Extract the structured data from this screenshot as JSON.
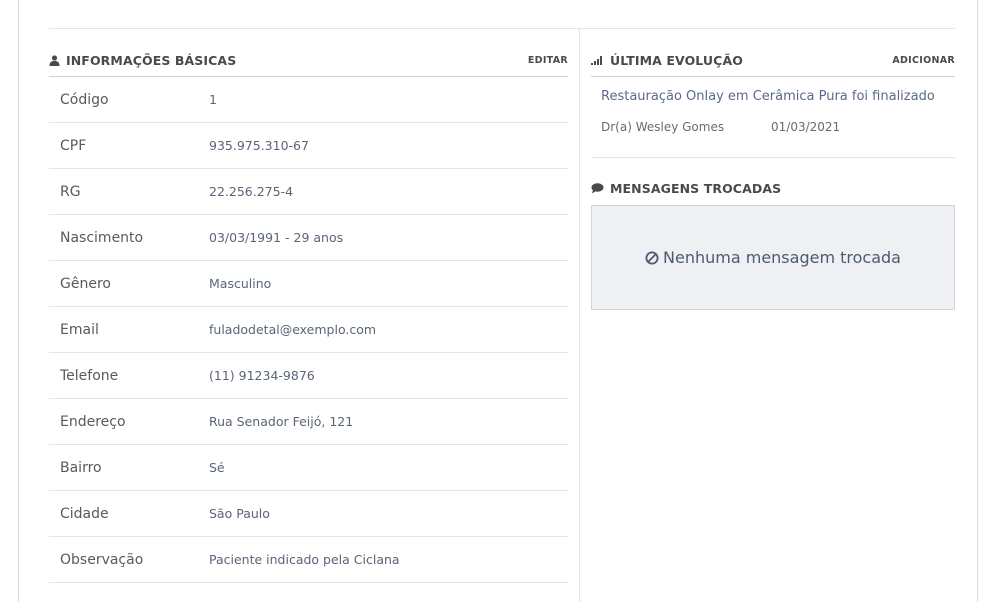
{
  "basic_info": {
    "title": "INFORMAÇÕES BÁSICAS",
    "edit_label": "EDITAR",
    "icon": "user-icon",
    "rows": [
      {
        "label": "Código",
        "value": "1"
      },
      {
        "label": "CPF",
        "value": "935.975.310-67"
      },
      {
        "label": "RG",
        "value": "22.256.275-4"
      },
      {
        "label": "Nascimento",
        "value": "03/03/1991 - 29 anos"
      },
      {
        "label": "Gênero",
        "value": "Masculino"
      },
      {
        "label": "Email",
        "value": "fuladodetal@exemplo.com"
      },
      {
        "label": "Telefone",
        "value": "(11) 91234-9876"
      },
      {
        "label": "Endereço",
        "value": "Rua Senador Feijó, 121"
      },
      {
        "label": "Bairro",
        "value": "Sé"
      },
      {
        "label": "Cidade",
        "value": "São Paulo"
      },
      {
        "label": "Observação",
        "value": "Paciente indicado pela Ciclana"
      }
    ]
  },
  "last_evolution": {
    "title": "ÚLTIMA EVOLUÇÃO",
    "add_label": "ADICIONAR",
    "icon": "signal-bars-icon",
    "description": "Restauração Onlay em Cerâmica Pura foi finalizado",
    "doctor": "Dr(a) Wesley Gomes",
    "date": "01/03/2021"
  },
  "messages": {
    "title": "MENSAGENS TROCADAS",
    "icon": "comment-icon",
    "empty_icon": "ban-icon",
    "empty_text": "Nenhuma mensagem trocada"
  },
  "colors": {
    "border": "#dcdcdc",
    "value_text": "#5a6577",
    "message_box_bg": "#eef0f4"
  }
}
